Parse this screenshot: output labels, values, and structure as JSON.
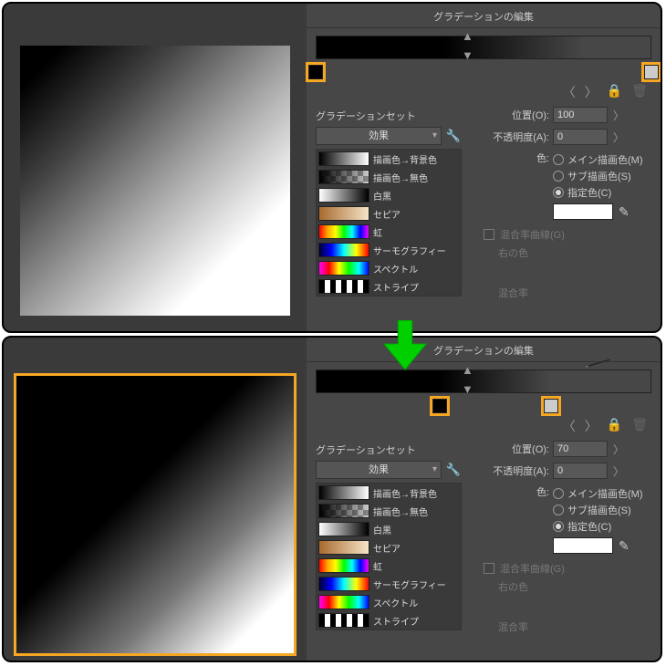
{
  "panel_title": "グラデーションの編集",
  "section_label": "グラデーションセット",
  "dropdown_value": "効果",
  "presets": [
    {
      "name": "描画色→背景色"
    },
    {
      "name": "描画色→無色"
    },
    {
      "name": "白黒"
    },
    {
      "name": "セピア"
    },
    {
      "name": "虹"
    },
    {
      "name": "サーモグラフィー"
    },
    {
      "name": "スペクトル"
    },
    {
      "name": "ストライプ"
    }
  ],
  "labels": {
    "position": "位置(O):",
    "opacity": "不透明度(A):",
    "color": "色:",
    "main_color": "メイン描画色(M)",
    "sub_color": "サブ描画色(S)",
    "spec_color": "指定色(C)",
    "mix_curve": "混合率曲線(G)",
    "right_color": "右の色",
    "mix_rate": "混合率"
  },
  "top": {
    "position_value": "100",
    "opacity_value": "0",
    "stop_left_pct": 0,
    "stop_right_pct": 100
  },
  "bot": {
    "position_value": "70",
    "opacity_value": "0",
    "stop_left_pct": 37,
    "stop_right_pct": 70
  }
}
